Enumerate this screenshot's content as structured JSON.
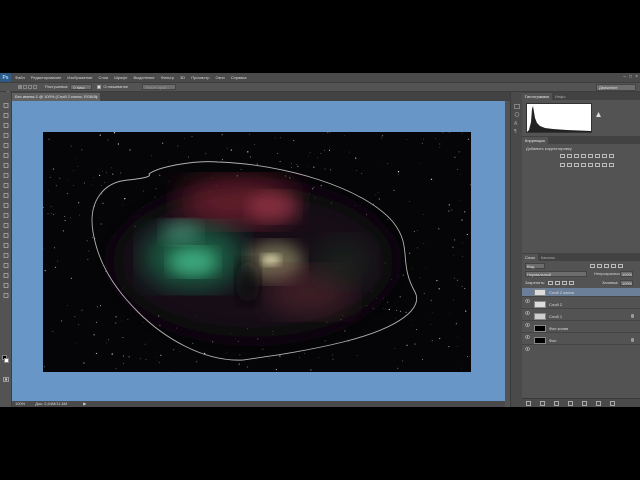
{
  "app": {
    "logo": "Ps"
  },
  "menu": {
    "items": [
      "Файл",
      "Редактирование",
      "Изображение",
      "Слои",
      "Шрифт",
      "Выделение",
      "Фильтр",
      "3D",
      "Просмотр",
      "Окно",
      "Справка"
    ]
  },
  "window_controls": [
    "–",
    "□",
    "×"
  ],
  "options_bar": {
    "feather_label": "Растушевка:",
    "feather_value": "0 пикс",
    "antialias_label": "Сглаживание",
    "refine_edge": "Уточн. край...",
    "workspace": "Движение"
  },
  "document": {
    "tab_title": "Без имени-1 @ 100% (Слой 2 копия, RGB/8)",
    "close": "×"
  },
  "status": {
    "zoom": "100%",
    "doc_info": "Док: 2,64M/11,6M",
    "arrow": "▶"
  },
  "panels": {
    "histogram_tabs": [
      "Гистограмма",
      "Инфо"
    ],
    "adjust_tabs": [
      "Коррекция"
    ],
    "adjust_title": "Добавить корректировку",
    "layers_tabs": [
      "Слои",
      "Каналы"
    ],
    "kind_label": "Вид",
    "blend_mode": "Нормальный",
    "opacity_label": "Непрозрачность:",
    "opacity_value": "100%",
    "lock_label": "Закрепить:",
    "fill_label": "Заливка:",
    "fill_value": "100%"
  },
  "layers": [
    {
      "name": "Слой 2 копия",
      "thumb": "#dcdcdc",
      "active": true,
      "locked": false
    },
    {
      "name": "Слой 2",
      "thumb": "#dcdcdc",
      "active": false,
      "locked": false
    },
    {
      "name": "Слой 1",
      "thumb": "#cfcfcf",
      "active": false,
      "locked": true
    },
    {
      "name": "Фон копия",
      "thumb": "#000000",
      "active": false,
      "locked": false
    },
    {
      "name": "Фон",
      "thumb": "#000000",
      "active": false,
      "locked": true
    }
  ],
  "colors": {
    "canvas_bg": "#6897c7",
    "ui_bg": "#535353",
    "active_layer": "#6b7f99"
  }
}
